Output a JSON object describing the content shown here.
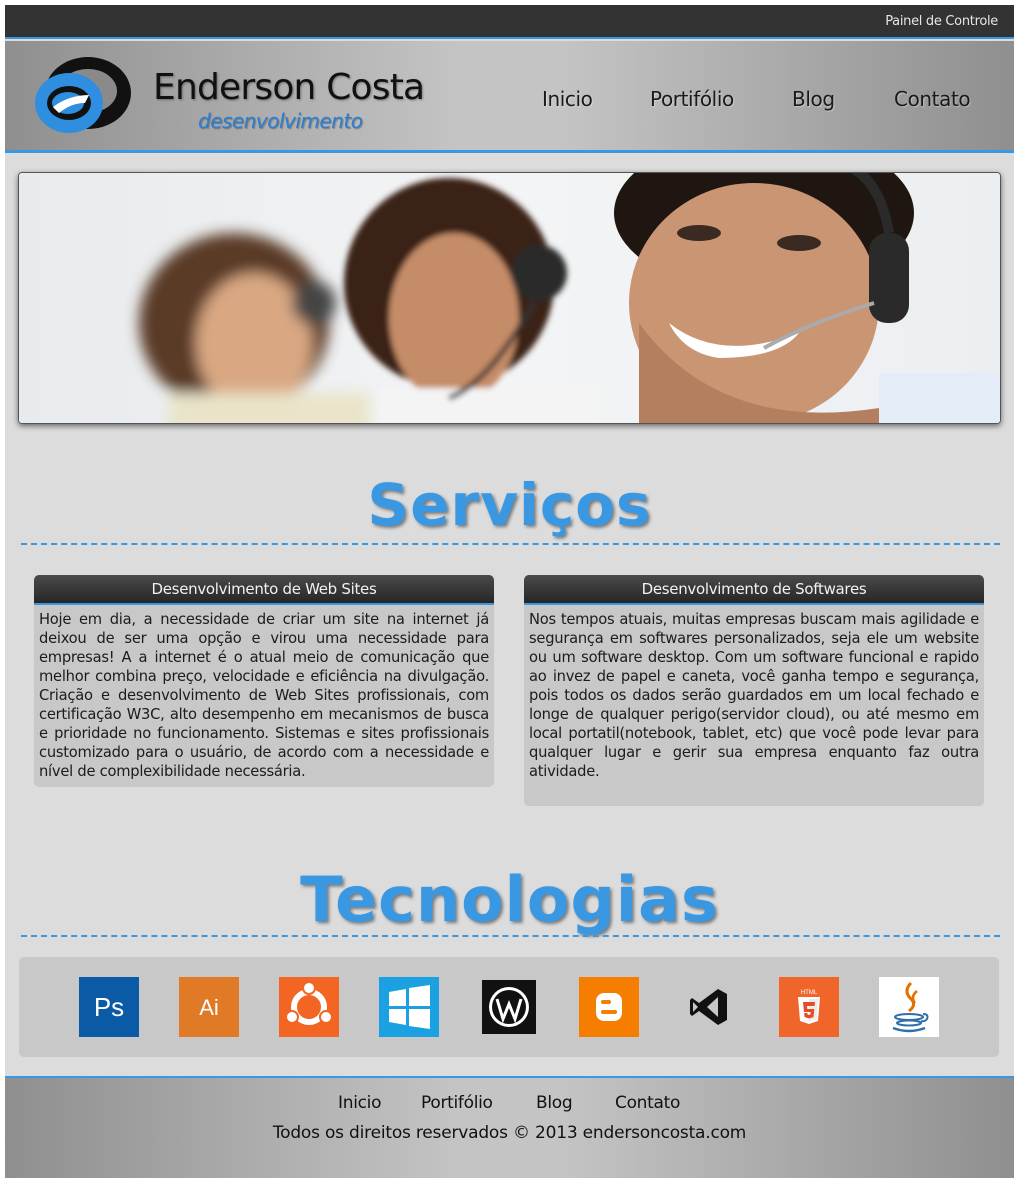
{
  "topbar": {
    "panel_link": "Painel de Controle"
  },
  "brand": {
    "name": "Enderson Costa",
    "subtitle": "desenvolvimento"
  },
  "nav": [
    "Inicio",
    "Portifólio",
    "Blog",
    "Contato"
  ],
  "services": {
    "title": "Serviços",
    "cards": [
      {
        "heading": "Desenvolvimento de Web Sites",
        "body": "Hoje em dia, a necessidade de criar um site na internet já deixou de ser uma opção e virou uma necessidade para empresas! A a internet é o atual meio de comunicação que melhor combina preço, velocidade e eficiência na divulgação. Criação e desenvolvimento de Web Sites profissionais, com certificação W3C, alto desempenho em mecanismos de busca e prioridade no funcionamento. Sistemas e sites profissionais customizado para o usuário, de acordo com a necessidade e nível de complexibilidade necessária."
      },
      {
        "heading": "Desenvolvimento de Softwares",
        "body": "Nos tempos atuais, muitas empresas buscam mais agilidade e segurança em softwares personalizados, seja ele um website ou um software desktop. Com um software funcional e rapido ao invez de papel e caneta, você ganha tempo e segurança, pois todos os dados serão guardados em um local fechado e longe de qualquer perigo(servidor cloud), ou até mesmo em local portatil(notebook, tablet, etc) que você pode levar para qualquer lugar e gerir sua empresa enquanto faz outra atividade."
      }
    ]
  },
  "technologies": {
    "title": "Tecnologias",
    "items": [
      {
        "icon": "photoshop-icon",
        "text": "Ps",
        "color": "#0b5aa6"
      },
      {
        "icon": "illustrator-icon",
        "text": "Ai",
        "color": "#e07a26"
      },
      {
        "icon": "ubuntu-icon",
        "color": "#f26522"
      },
      {
        "icon": "windows-icon",
        "color": "#1ba1e2"
      },
      {
        "icon": "wordpress-icon",
        "color": "#111111"
      },
      {
        "icon": "blogger-icon",
        "color": "#f57d00"
      },
      {
        "icon": "visual-studio-icon",
        "color": "#111111"
      },
      {
        "icon": "html5-icon",
        "text": "HTML",
        "color": "#e44d26"
      },
      {
        "icon": "java-icon",
        "color": "#e76f00"
      }
    ]
  },
  "footer": {
    "nav": [
      "Inicio",
      "Portifólio",
      "Blog",
      "Contato"
    ],
    "copyright": "Todos os direitos reservados © 2013 endersoncosta.com"
  },
  "colors": {
    "accent": "#3a98e3",
    "topbar": "#333333",
    "page_bg": "#dcdcdc",
    "card_bg": "#c8c8c8"
  }
}
